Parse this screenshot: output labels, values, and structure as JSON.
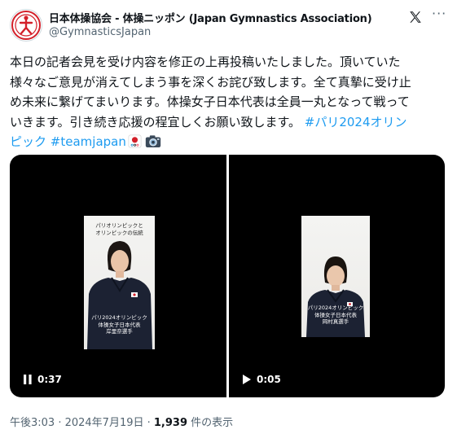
{
  "account": {
    "name": "日本体操協会 - 体操ニッポン (Japan Gymnastics Association)",
    "handle": "@GymnasticsJapan"
  },
  "tweet": {
    "line1": "本日の記者会見を受け内容を修正の上再投稿いたしました。頂いていた",
    "line2": "様々なご意見が消えてしまう事を深くお詫び致します。全て真摯に受け止",
    "line3": "め未来に繋げてまいります。体操女子日本代表は全員一丸となって戦って",
    "line4_text": "いきます。引き続き応援の程宜しくお願い致します。 ",
    "hashtag_paris": "#パリ2024オリン",
    "hashtag_paris_cont": "ピック",
    "hashtag_team": "#teamjapan"
  },
  "videos": [
    {
      "duration": "0:37",
      "state": "paused",
      "caption_top": [
        "パリオリンピックと",
        "オリンピックの伝統"
      ],
      "caption_bottom": [
        "パリ2024オリンピック",
        "体操女子日本代表",
        "岸里奈選手"
      ]
    },
    {
      "duration": "0:05",
      "state": "play",
      "caption_bottom": [
        "パリ2024オリンピック",
        "体操女子日本代表",
        "岡村真選手"
      ]
    }
  ],
  "meta": {
    "time": "午後3:03 · 2024年7月19日 · ",
    "views_count": "1,939",
    "views_label": " 件の表示"
  },
  "colors": {
    "hashtag": "#1d9bf0",
    "muted_text": "#536471",
    "text": "#0f1419",
    "logo_red": "#d3202a"
  }
}
